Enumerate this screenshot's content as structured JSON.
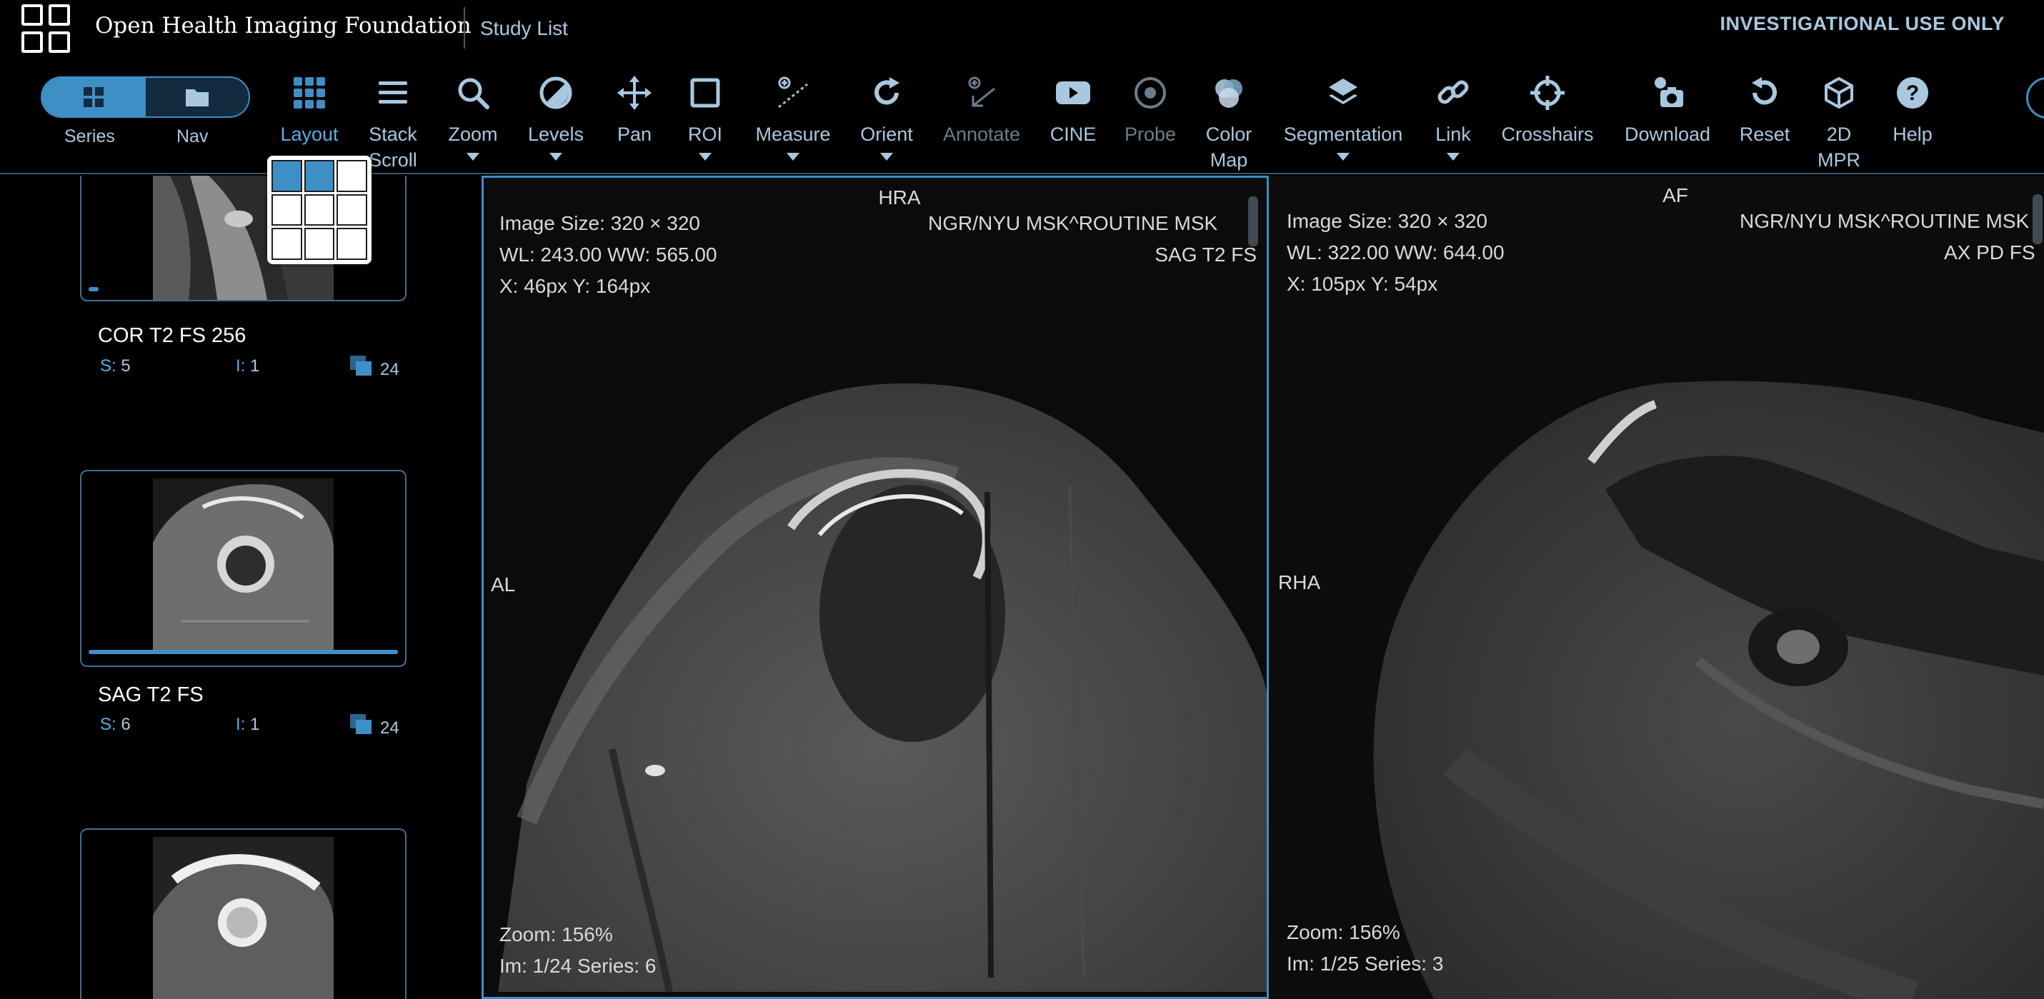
{
  "app": {
    "title": "Open Health Imaging Foundation",
    "study_list": "Study List",
    "notice": "INVESTIGATIONAL USE ONLY"
  },
  "panel_toggle": {
    "series_label": "Series",
    "nav_label": "Nav"
  },
  "toolbar": {
    "layout": "Layout",
    "stack_scroll_1": "Stack",
    "stack_scroll_2": "Scroll",
    "zoom": "Zoom",
    "levels": "Levels",
    "pan": "Pan",
    "roi": "ROI",
    "measure": "Measure",
    "orient": "Orient",
    "annotate": "Annotate",
    "cine": "CINE",
    "probe": "Probe",
    "color_map_1": "Color",
    "color_map_2": "Map",
    "segmentation": "Segmentation",
    "link": "Link",
    "crosshairs": "Crosshairs",
    "download": "Download",
    "reset": "Reset",
    "mpr_1": "2D",
    "mpr_2": "MPR",
    "help": "Help"
  },
  "layout_picker": {
    "rows": 3,
    "cols": 3,
    "selected": [
      [
        0,
        0
      ],
      [
        0,
        1
      ]
    ]
  },
  "series": [
    {
      "name": "COR T2 FS 256",
      "s_label": "S:",
      "s_value": "5",
      "i_label": "I:",
      "i_value": "1",
      "count": "24"
    },
    {
      "name": "SAG T2 FS",
      "s_label": "S:",
      "s_value": "6",
      "i_label": "I:",
      "i_value": "1",
      "count": "24"
    },
    {
      "name": "",
      "s_label": "",
      "s_value": "",
      "i_label": "",
      "i_value": "",
      "count": ""
    }
  ],
  "viewports": [
    {
      "orient_top": "HRA",
      "orient_left": "AL",
      "image_size": "Image Size: 320 × 320",
      "wl_ww": "WL: 243.00 WW: 565.00",
      "xy": "X: 46px Y: 164px",
      "study": "NGR/NYU MSK^ROUTINE MSK",
      "series_desc": "SAG T2 FS",
      "zoom": "Zoom: 156%",
      "im_series": "Im: 1/24 Series: 6"
    },
    {
      "orient_top": "AF",
      "orient_left": "RHA",
      "image_size": "Image Size: 320 × 320",
      "wl_ww": "WL: 322.00 WW: 644.00",
      "xy": "X: 105px Y: 54px",
      "study": "NGR/NYU MSK^ROUTINE MSK",
      "series_desc": "AX PD FS",
      "zoom": "Zoom: 156%",
      "im_series": "Im: 1/25 Series: 3"
    }
  ],
  "colors": {
    "accent": "#3e8fc6",
    "text_muted": "#a9c8df",
    "background": "#000000"
  }
}
